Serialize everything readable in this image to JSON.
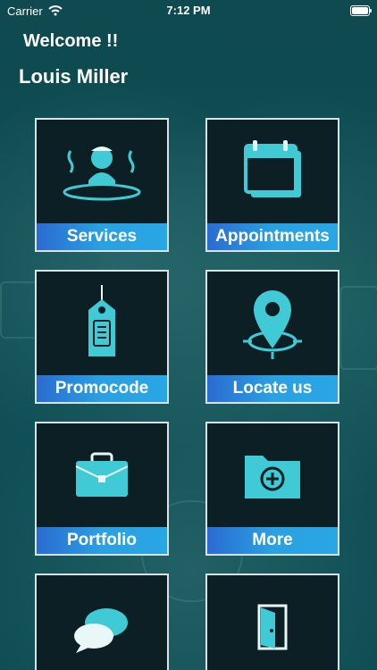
{
  "status": {
    "carrier": "Carrier",
    "time": "7:12 PM"
  },
  "header": {
    "welcome": "Welcome !!",
    "user_name": "Louis Miller"
  },
  "tiles": [
    {
      "label": "Services",
      "icon": "spa-person-icon"
    },
    {
      "label": "Appointments",
      "icon": "calendar-icon"
    },
    {
      "label": "Promocode",
      "icon": "tag-icon"
    },
    {
      "label": "Locate us",
      "icon": "map-pin-icon"
    },
    {
      "label": "Portfolio",
      "icon": "briefcase-icon"
    },
    {
      "label": "More",
      "icon": "folder-plus-icon"
    },
    {
      "label": "",
      "icon": "chat-bubbles-icon"
    },
    {
      "label": "",
      "icon": "door-exit-icon"
    }
  ],
  "colors": {
    "accent": "#2aa6e4",
    "tile_bg": "#0c1f24",
    "icon": "#3fcad6"
  }
}
